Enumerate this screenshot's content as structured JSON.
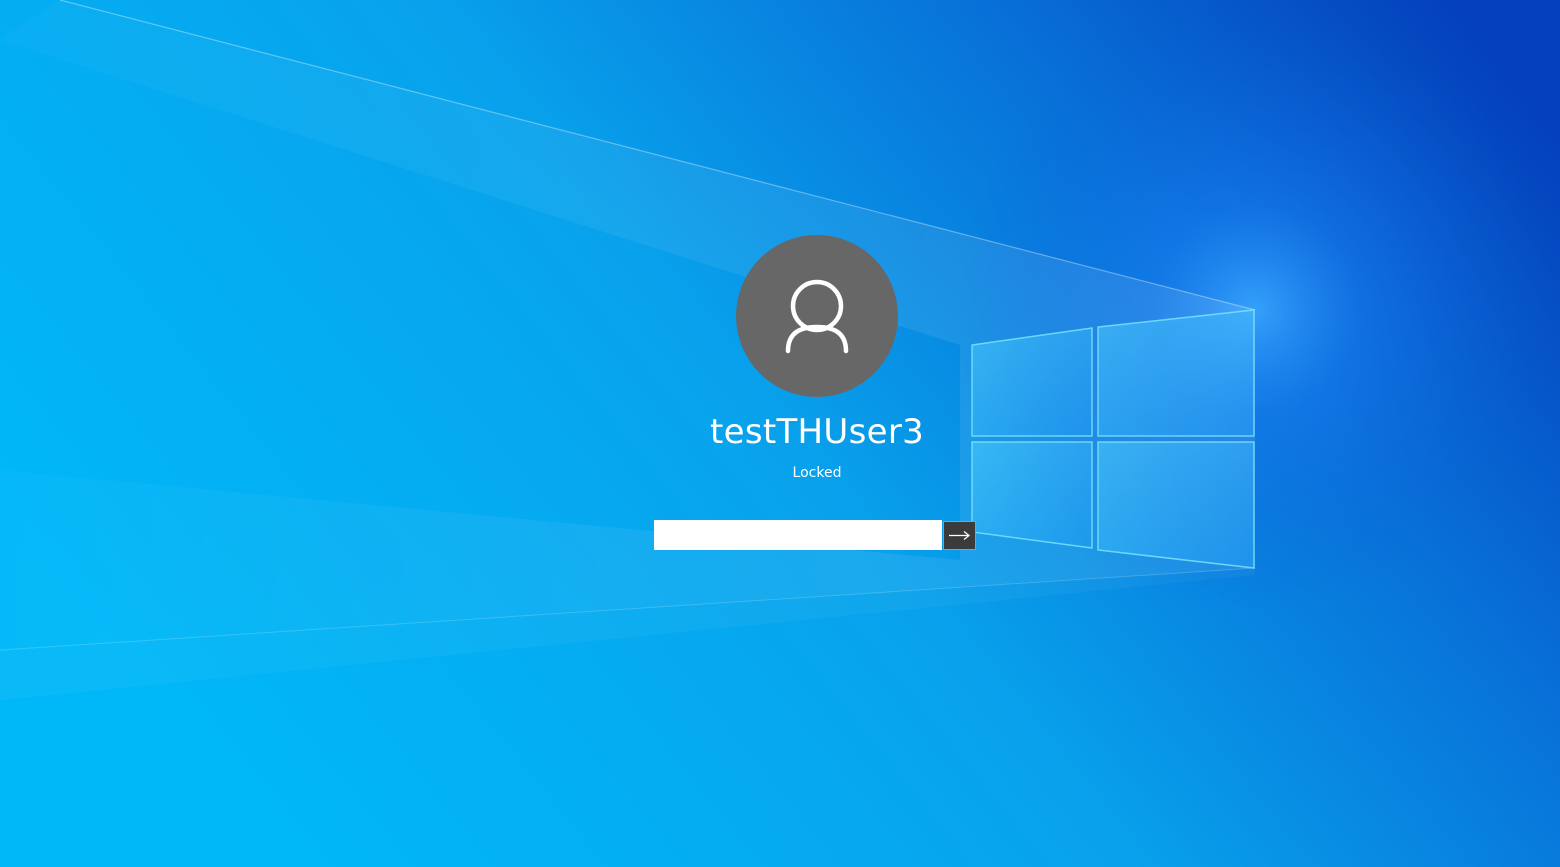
{
  "lock_screen": {
    "username": "testTHUser3",
    "status": "Locked",
    "password_placeholder": ""
  },
  "icons": {
    "avatar": "user-silhouette-icon",
    "submit": "arrow-right-icon",
    "logo": "windows-logo-icon"
  },
  "colors": {
    "background_light": "#00b4f5",
    "background_dark": "#0048c0",
    "avatar_fill": "#676767",
    "text": "#ffffff",
    "submit_button": "#3b3b3b"
  }
}
